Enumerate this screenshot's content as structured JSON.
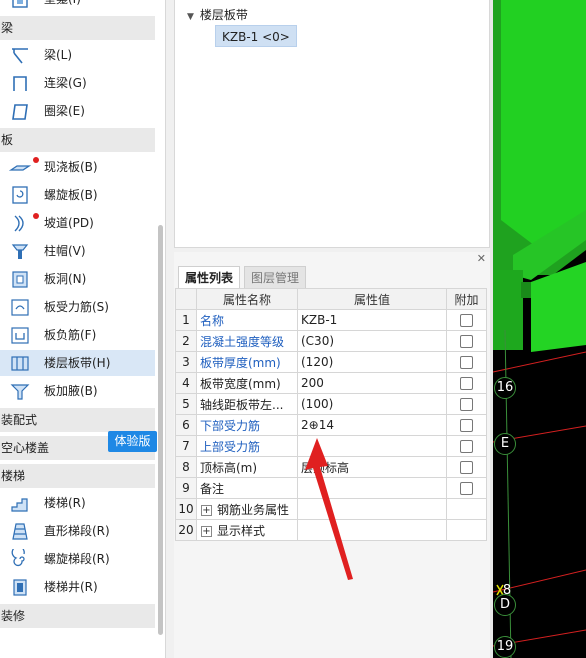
{
  "component_tree": {
    "items": [
      {
        "type": "item",
        "label": "壁龛(I)",
        "icon": "niche-icon",
        "name": "tree-item-niche"
      },
      {
        "type": "group",
        "label": "梁",
        "name": "group-beam"
      },
      {
        "type": "item",
        "label": "梁(L)",
        "icon": "beam-icon",
        "name": "tree-item-beam"
      },
      {
        "type": "item",
        "label": "连梁(G)",
        "icon": "coupling-beam-icon",
        "name": "tree-item-coupling-beam"
      },
      {
        "type": "item",
        "label": "圈梁(E)",
        "icon": "ring-beam-icon",
        "name": "tree-item-ring-beam"
      },
      {
        "type": "group",
        "label": "板",
        "name": "group-slab"
      },
      {
        "type": "item",
        "label": "现浇板(B)",
        "icon": "cast-slab-icon",
        "name": "tree-item-cast-slab",
        "dot": true
      },
      {
        "type": "item",
        "label": "螺旋板(B)",
        "icon": "spiral-slab-icon",
        "name": "tree-item-spiral-slab"
      },
      {
        "type": "item",
        "label": "坡道(PD)",
        "icon": "ramp-icon",
        "name": "tree-item-ramp",
        "dot": true
      },
      {
        "type": "item",
        "label": "柱帽(V)",
        "icon": "column-cap-icon",
        "name": "tree-item-column-cap"
      },
      {
        "type": "item",
        "label": "板洞(N)",
        "icon": "slab-hole-icon",
        "name": "tree-item-slab-hole"
      },
      {
        "type": "item",
        "label": "板受力筋(S)",
        "icon": "slab-rebar-icon",
        "name": "tree-item-slab-rebar"
      },
      {
        "type": "item",
        "label": "板负筋(F)",
        "icon": "slab-neg-rebar-icon",
        "name": "tree-item-slab-neg-rebar"
      },
      {
        "type": "item",
        "label": "楼层板带(H)",
        "icon": "floor-strip-icon",
        "name": "tree-item-floor-strip",
        "selected": true
      },
      {
        "type": "item",
        "label": "板加腋(B)",
        "icon": "slab-haunch-icon",
        "name": "tree-item-slab-haunch"
      },
      {
        "type": "group",
        "label": "装配式",
        "name": "group-prefab"
      },
      {
        "type": "group",
        "label": "空心楼盖",
        "name": "group-hollow-floor"
      },
      {
        "type": "group",
        "label": "楼梯",
        "name": "group-stairs"
      },
      {
        "type": "item",
        "label": "楼梯(R)",
        "icon": "stairs-icon",
        "name": "tree-item-stairs"
      },
      {
        "type": "item",
        "label": "直形梯段(R)",
        "icon": "straight-flight-icon",
        "name": "tree-item-straight-flight"
      },
      {
        "type": "item",
        "label": "螺旋梯段(R)",
        "icon": "spiral-flight-icon",
        "name": "tree-item-spiral-flight"
      },
      {
        "type": "item",
        "label": "楼梯井(R)",
        "icon": "stair-well-icon",
        "name": "tree-item-stair-well"
      },
      {
        "type": "group",
        "label": "装修",
        "name": "group-decoration"
      }
    ],
    "trial_badge": "体验版"
  },
  "component_list": {
    "root": "楼层板带",
    "node": "KZB-1 <0>"
  },
  "properties": {
    "tabs": [
      "属性列表",
      "图层管理"
    ],
    "headers": {
      "name": "属性名称",
      "value": "属性值",
      "extra": "附加"
    },
    "rows": [
      {
        "num": "1",
        "name": "名称",
        "value": "KZB-1",
        "blue": true,
        "check": true
      },
      {
        "num": "2",
        "name": "混凝土强度等级",
        "value": "(C30)",
        "blue": true,
        "check": true
      },
      {
        "num": "3",
        "name": "板带厚度(mm)",
        "value": "(120)",
        "blue": true,
        "check": true
      },
      {
        "num": "4",
        "name": "板带宽度(mm)",
        "value": "200",
        "blue": false,
        "check": true
      },
      {
        "num": "5",
        "name": "轴线距板带左...",
        "value": "(100)",
        "blue": false,
        "check": true
      },
      {
        "num": "6",
        "name": "下部受力筋",
        "value": "2⊕14",
        "blue": true,
        "check": true
      },
      {
        "num": "7",
        "name": "上部受力筋",
        "value": "",
        "blue": true,
        "check": true
      },
      {
        "num": "8",
        "name": "顶标高(m)",
        "value": "层顶标高",
        "blue": false,
        "check": true
      },
      {
        "num": "9",
        "name": "备注",
        "value": "",
        "blue": false,
        "check": true
      },
      {
        "num": "10",
        "name": "钢筋业务属性",
        "value": "",
        "blue": false,
        "check": false,
        "expand": true
      },
      {
        "num": "20",
        "name": "显示样式",
        "value": "",
        "blue": false,
        "check": false,
        "expand": true
      }
    ]
  },
  "viewport": {
    "axis_labels": [
      "16",
      "E",
      "8",
      "D",
      "19"
    ]
  },
  "colors": {
    "accent": "#1e88e5",
    "selected_row": "#d9e7f6",
    "blue_text": "#1f5fbf",
    "slab_green": "#22d022",
    "annotation_red": "#e02020"
  }
}
